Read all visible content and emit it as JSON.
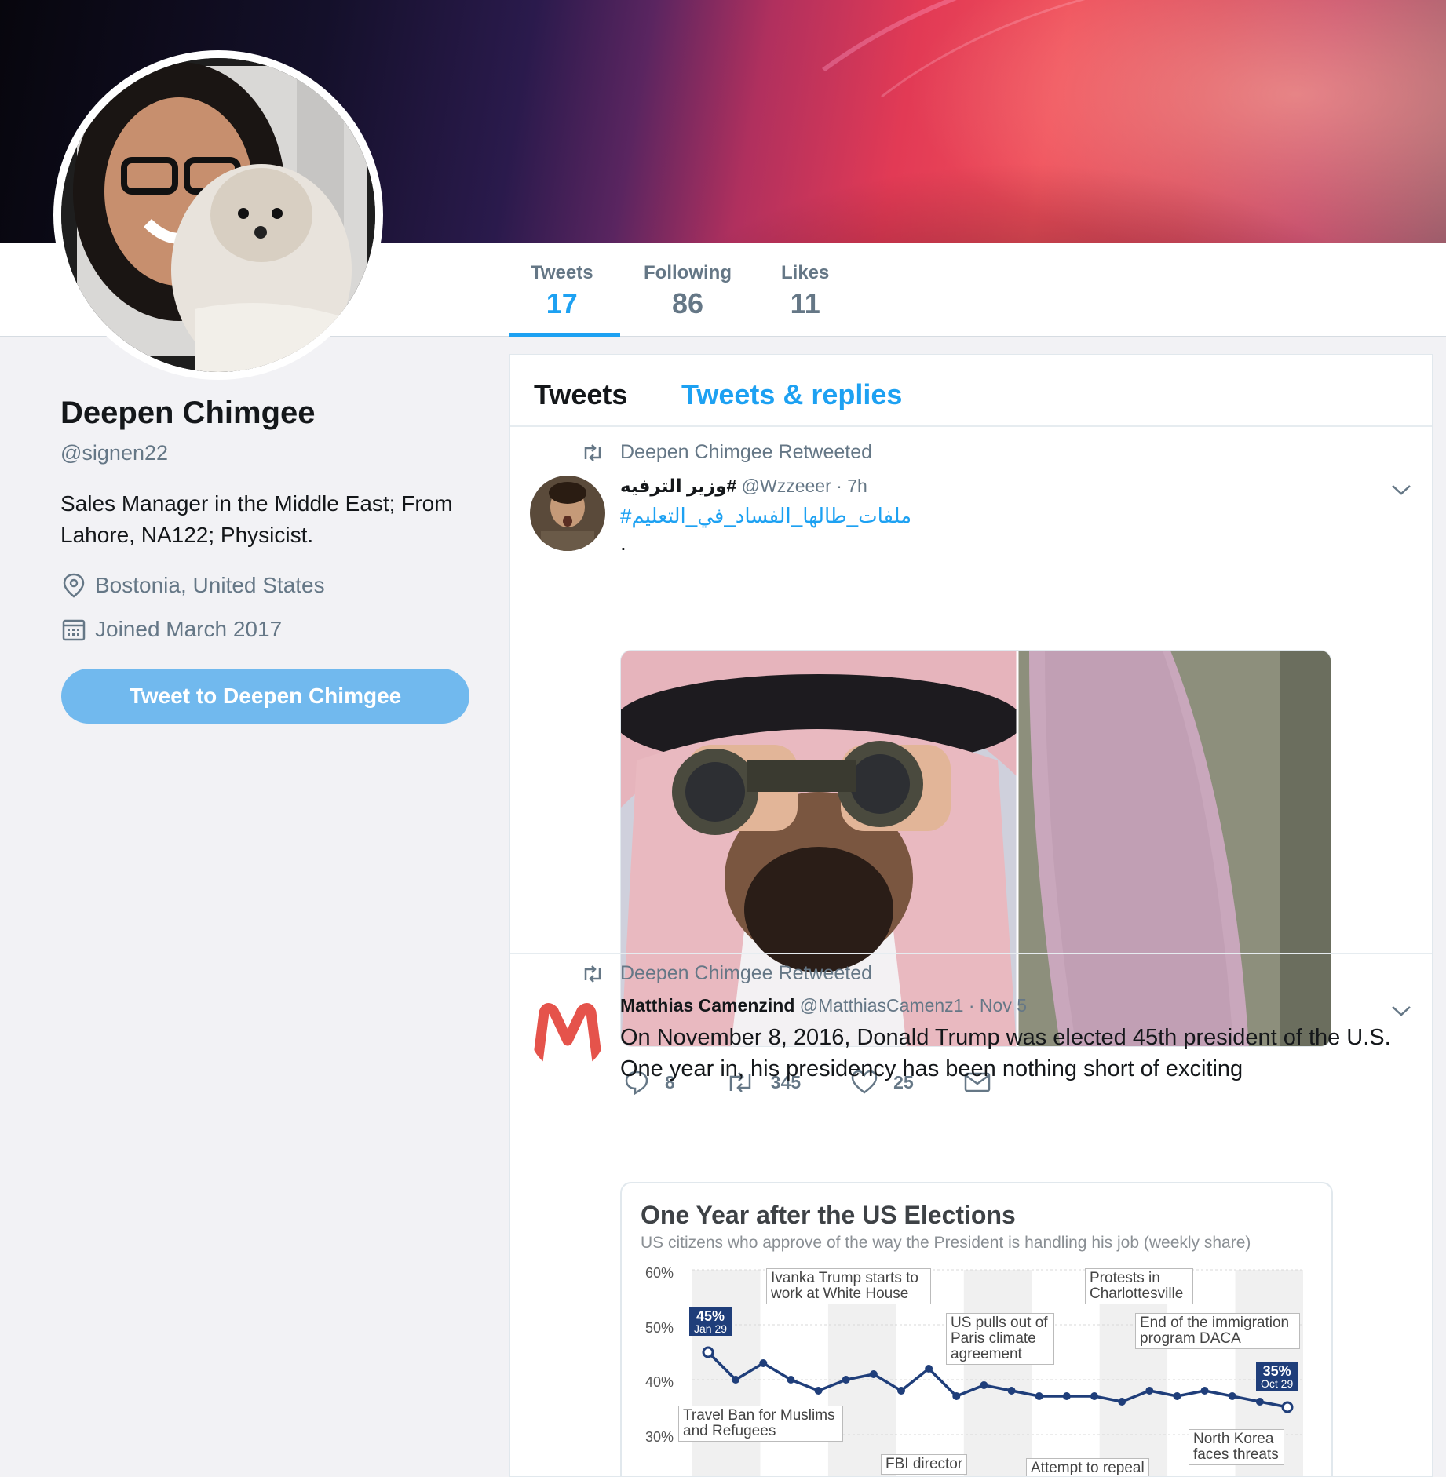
{
  "profile": {
    "name": "Deepen Chimgee",
    "handle": "@signen22",
    "bio": "Sales Manager in the Middle East; From Lahore, NA122; Physicist.",
    "location": "Bostonia, United States",
    "joined": "Joined March 2017",
    "tweet_to_label": "Tweet to Deepen Chimgee"
  },
  "stats": [
    {
      "label": "Tweets",
      "value": "17"
    },
    {
      "label": "Following",
      "value": "86"
    },
    {
      "label": "Likes",
      "value": "11"
    }
  ],
  "timeline_tabs": [
    "Tweets",
    "Tweets & replies"
  ],
  "tweets": [
    {
      "retweet_label": "Deepen Chimgee Retweeted",
      "author_name": "وزير الترفيه#",
      "author_handle": "@Wzzeeer",
      "time": "· 7h",
      "hashtag": "#ملفات_طالها_الفساد_في_التعليم",
      "text": ".",
      "replies": "8",
      "retweets": "345",
      "likes": "25"
    },
    {
      "retweet_label": "Deepen Chimgee Retweeted",
      "author_name": "Matthias Camenzind",
      "author_handle": "@MatthiasCamenz1",
      "time": "· Nov 5",
      "text": "On November 8, 2016, Donald Trump was elected 45th president of the U.S. One year in, his presidency has been nothing short of exciting"
    }
  ],
  "chart_data": {
    "type": "line",
    "title": "One Year after the US Elections",
    "subtitle": "US citizens who approve of the way the President is handling his job (weekly share)",
    "yticks": [
      "60%",
      "50%",
      "40%",
      "30%"
    ],
    "ylim": [
      30,
      60
    ],
    "series": [
      {
        "values": [
          45,
          40,
          43,
          40,
          38,
          40,
          41,
          38,
          42,
          37,
          39,
          38,
          37,
          37,
          37,
          36,
          38,
          37,
          38,
          37,
          36,
          35
        ]
      }
    ],
    "start_label": {
      "value": "45%",
      "date": "Jan 29"
    },
    "end_label": {
      "value": "35%",
      "date": "Oct 29"
    },
    "annotations": [
      "Ivanka Trump starts to work at White House",
      "Protests in Charlottesville",
      "US pulls out of Paris climate agreement",
      "End of the immigration program DACA",
      "Travel Ban for Muslims and Refugees",
      "North Korea faces threats",
      "FBI director",
      "Attempt to repeal"
    ],
    "colors": {
      "line": "#1f3e7a",
      "flag": "#1f3e7a"
    }
  }
}
